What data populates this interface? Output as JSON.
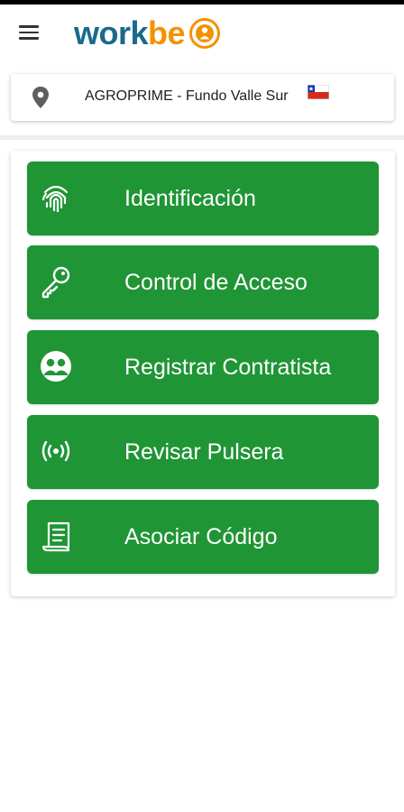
{
  "header": {
    "menu_icon": "hamburger-menu-icon",
    "logo": {
      "part1": "work",
      "part2": "be",
      "color_primary": "#1a6a8c",
      "color_accent": "#f39200"
    }
  },
  "location": {
    "icon": "location-pin-icon",
    "label": "AGROPRIME - Fundo Valle Sur",
    "flag": "chile-flag"
  },
  "menu": {
    "button_color": "#1f9535",
    "items": [
      {
        "icon": "fingerprint-icon",
        "label": "Identificación"
      },
      {
        "icon": "key-icon",
        "label": "Control de Acceso"
      },
      {
        "icon": "contractor-group-icon",
        "label": "Registrar Contratista"
      },
      {
        "icon": "wireless-signal-icon",
        "label": "Revisar Pulsera"
      },
      {
        "icon": "scroll-document-icon",
        "label": "Asociar Código"
      }
    ]
  }
}
